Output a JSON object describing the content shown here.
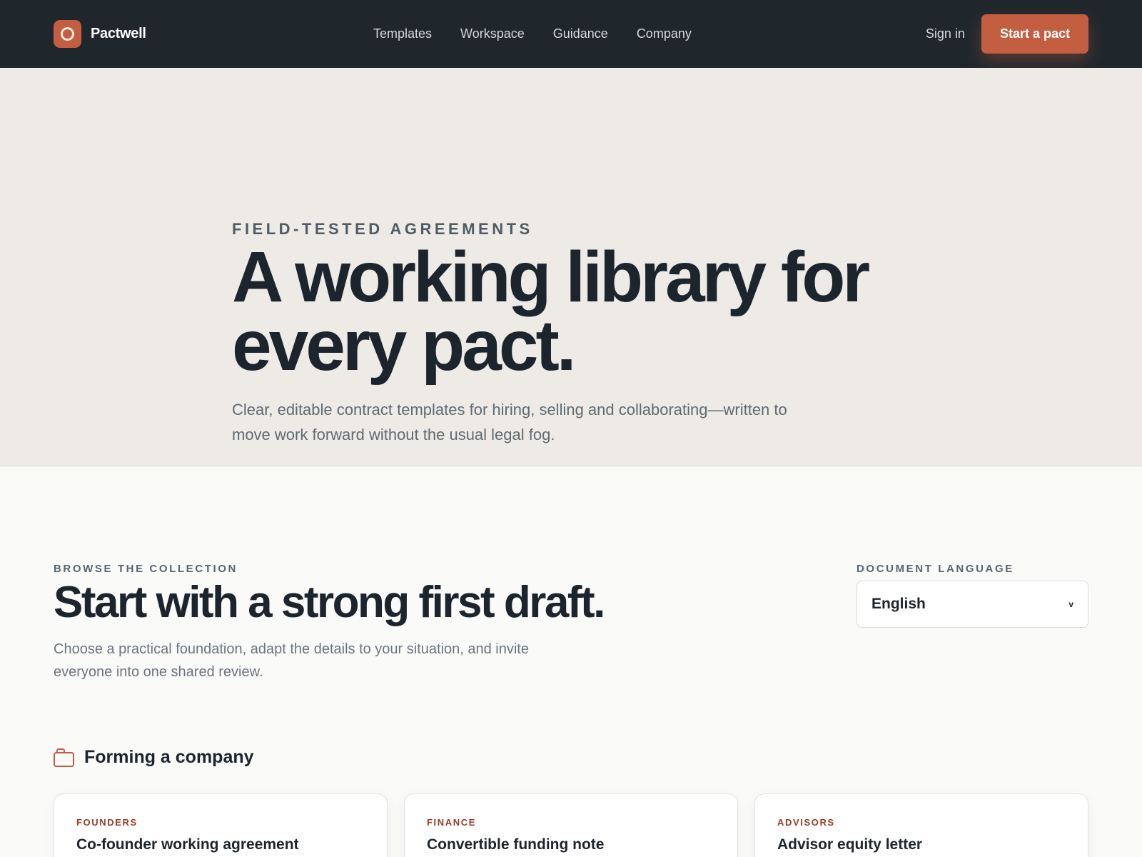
{
  "header": {
    "brand": "Pactwell",
    "nav": [
      "Templates",
      "Workspace",
      "Guidance",
      "Company"
    ],
    "sign_in": "Sign in",
    "cta": "Start a pact"
  },
  "hero": {
    "eyebrow": "FIELD-TESTED AGREEMENTS",
    "title_line1": "A working library for",
    "title_line2": "every pact.",
    "subtitle": "Clear, editable contract templates for hiring, selling and collaborating—written to move work forward without the usual legal fog."
  },
  "collection": {
    "eyebrow": "BROWSE THE COLLECTION",
    "title": "Start with a strong first draft.",
    "subtitle": "Choose a practical foundation, adapt the details to your situation, and invite everyone into one shared review.",
    "language": {
      "label": "DOCUMENT LANGUAGE",
      "value": "English"
    },
    "group": {
      "icon": "folder-icon",
      "title": "Forming a company",
      "cards": [
        {
          "tag": "FOUNDERS",
          "name": "Co-founder working agreement"
        },
        {
          "tag": "FINANCE",
          "name": "Convertible funding note"
        },
        {
          "tag": "ADVISORS",
          "name": "Advisor equity letter"
        }
      ]
    }
  },
  "colors": {
    "accent": "#c45e40",
    "header_bg": "#1f272d",
    "hero_bg": "#eeebe6",
    "text_dark": "#1c252e",
    "tag_color": "#9a3b22"
  }
}
